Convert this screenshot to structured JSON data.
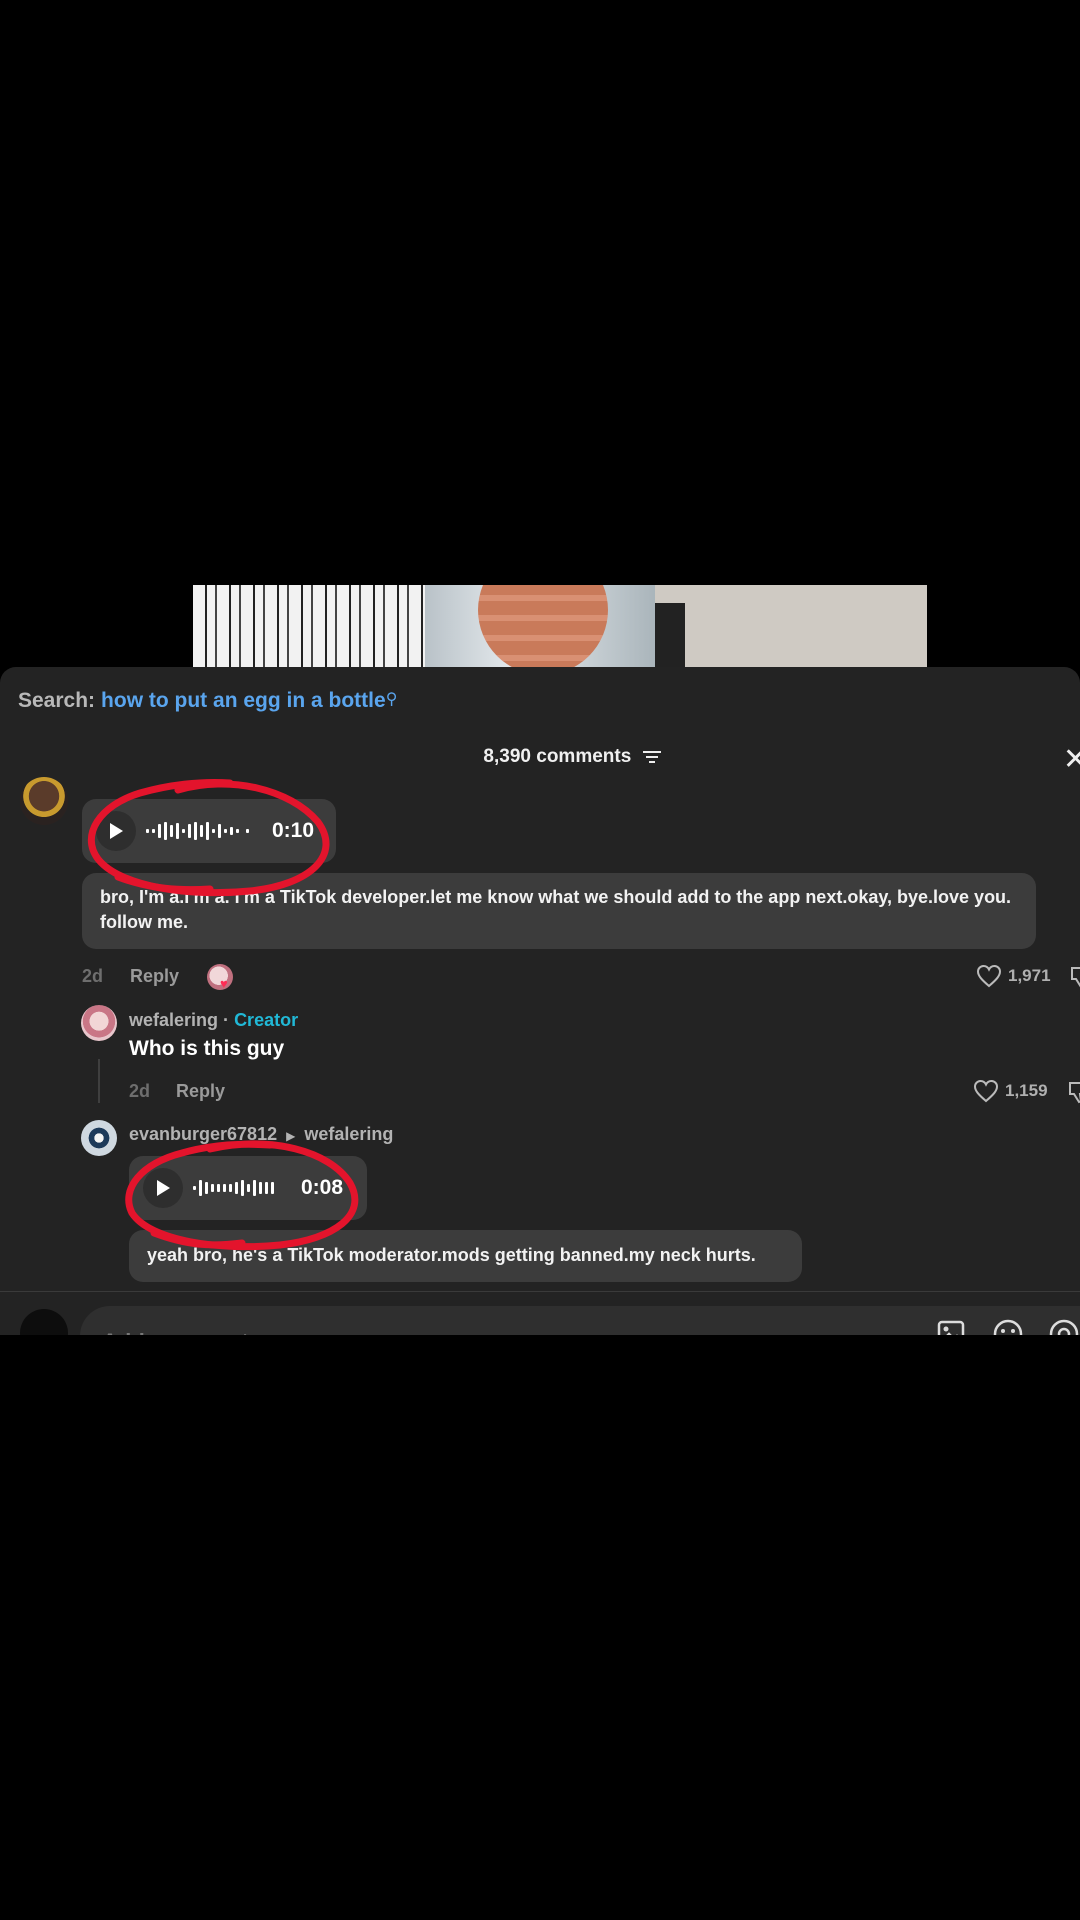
{
  "search": {
    "label": "Search:",
    "query": "how to put an egg in a bottle"
  },
  "comments_header": {
    "count_label": "8,390 comments"
  },
  "comment_1": {
    "voice_duration": "0:10",
    "transcript": "bro, I'm a.I'm a. I'm a TikTok developer.let me know what we should add to the app next.okay, bye.love you. follow me.",
    "time": "2d",
    "reply_label": "Reply",
    "likes": "1,971"
  },
  "reply_1": {
    "username": "wefalering",
    "separator": "·",
    "badge": "Creator",
    "text": "Who is this guy",
    "time": "2d",
    "reply_label": "Reply",
    "likes": "1,159"
  },
  "reply_2": {
    "username": "evanburger67812",
    "reply_to": "wefalering",
    "voice_duration": "0:08",
    "transcript": "yeah bro, he's a TikTok moderator.mods getting banned.my neck hurts."
  },
  "input": {
    "placeholder": "Add comment..."
  },
  "colors": {
    "accent_red": "#fe2c55",
    "link_blue": "#5aa5ee",
    "creator_teal": "#21b8d6",
    "annotation_red": "#e3142c"
  },
  "icons": [
    "play-icon",
    "waveform-icon",
    "sort-icon",
    "close-icon",
    "heart-icon",
    "dislike-icon",
    "image-icon",
    "emoji-icon",
    "mention-icon",
    "search-icon"
  ]
}
